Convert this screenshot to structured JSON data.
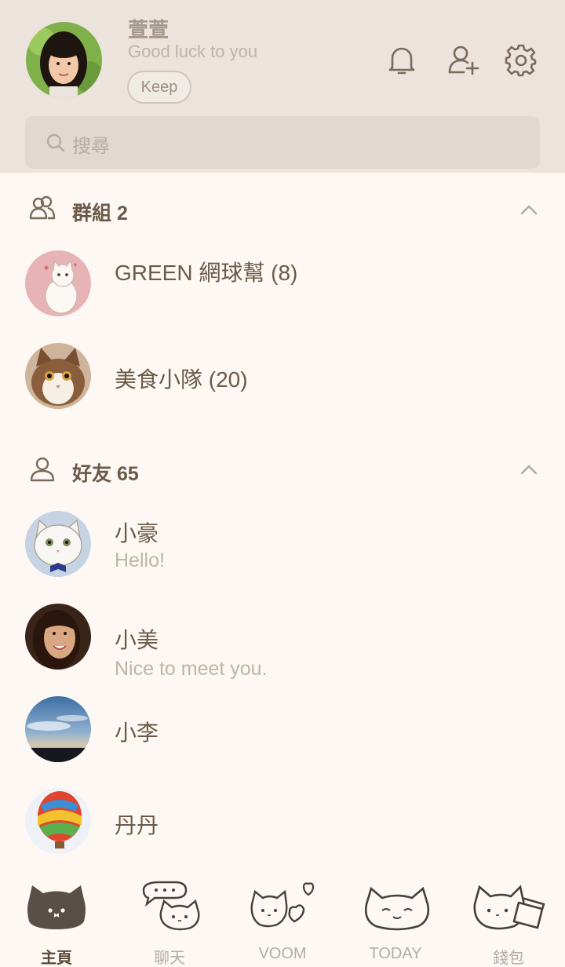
{
  "profile": {
    "name": "萱萱",
    "status": "Good luck to you",
    "keep_label": "Keep"
  },
  "search": {
    "placeholder": "搜尋"
  },
  "groups": {
    "title": "群組 2",
    "items": [
      {
        "name": "GREEN 網球幫 (8)"
      },
      {
        "name": "美食小隊 (20)"
      }
    ]
  },
  "friends": {
    "title": "好友 65",
    "items": [
      {
        "name": "小豪",
        "status": "Hello!"
      },
      {
        "name": "小美",
        "status": "Nice to meet you."
      },
      {
        "name": "小李"
      },
      {
        "name": "丹丹"
      }
    ]
  },
  "tabs": [
    {
      "label": "主頁",
      "icon": "cat-home-icon",
      "active": true
    },
    {
      "label": "聊天",
      "icon": "cat-chat-icon"
    },
    {
      "label": "VOOM",
      "icon": "cat-voom-icon"
    },
    {
      "label": "TODAY",
      "icon": "cat-today-icon"
    },
    {
      "label": "錢包",
      "icon": "cat-wallet-icon"
    }
  ],
  "colors": {
    "header_bg": "#ebe3dc",
    "page_bg": "#fdf8f4",
    "text": "#6b5a48",
    "muted": "#bfb4a8"
  }
}
